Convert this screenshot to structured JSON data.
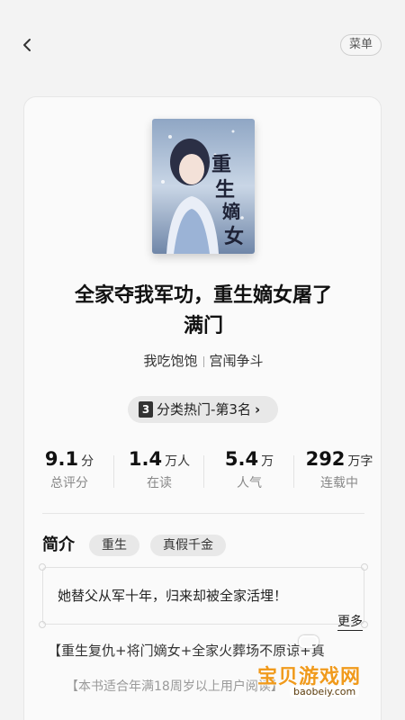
{
  "topbar": {
    "back_icon": "chevron-left-icon",
    "menu_label": "菜单"
  },
  "book": {
    "cover_icon": "book-cover-image",
    "title_line1": "全家夺我军功，重生嫡女屠了",
    "title_line2": "满门",
    "author": "我吃饱饱",
    "category": "宫闱争斗",
    "rank_number": "3",
    "rank_label": "分类热门-第3名",
    "rank_chevron": "›"
  },
  "stats": [
    {
      "value": "9.1",
      "unit": "分",
      "label": "总评分"
    },
    {
      "value": "1.4",
      "unit": "万人",
      "label": "在读"
    },
    {
      "value": "5.4",
      "unit": "万",
      "label": "人气"
    },
    {
      "value": "292",
      "unit": "万字",
      "label": "连载中"
    }
  ],
  "intro": {
    "heading": "简介",
    "tags": [
      "重生",
      "真假千金"
    ],
    "quote": "她替父从军十年，归来却被全家活埋！",
    "more_label": "更多",
    "desc_line1": "【重生复仇+将门嫡女+全家火葬场不原谅+真",
    "desc_line2": "【本书适合年满18周岁以上用户阅读】"
  },
  "watermark": {
    "main": "宝贝游戏网",
    "sub": "baobeiy.com"
  },
  "colors": {
    "background": "#f3f3f3",
    "card": "#fafafa",
    "watermark": "#f09a1c"
  }
}
